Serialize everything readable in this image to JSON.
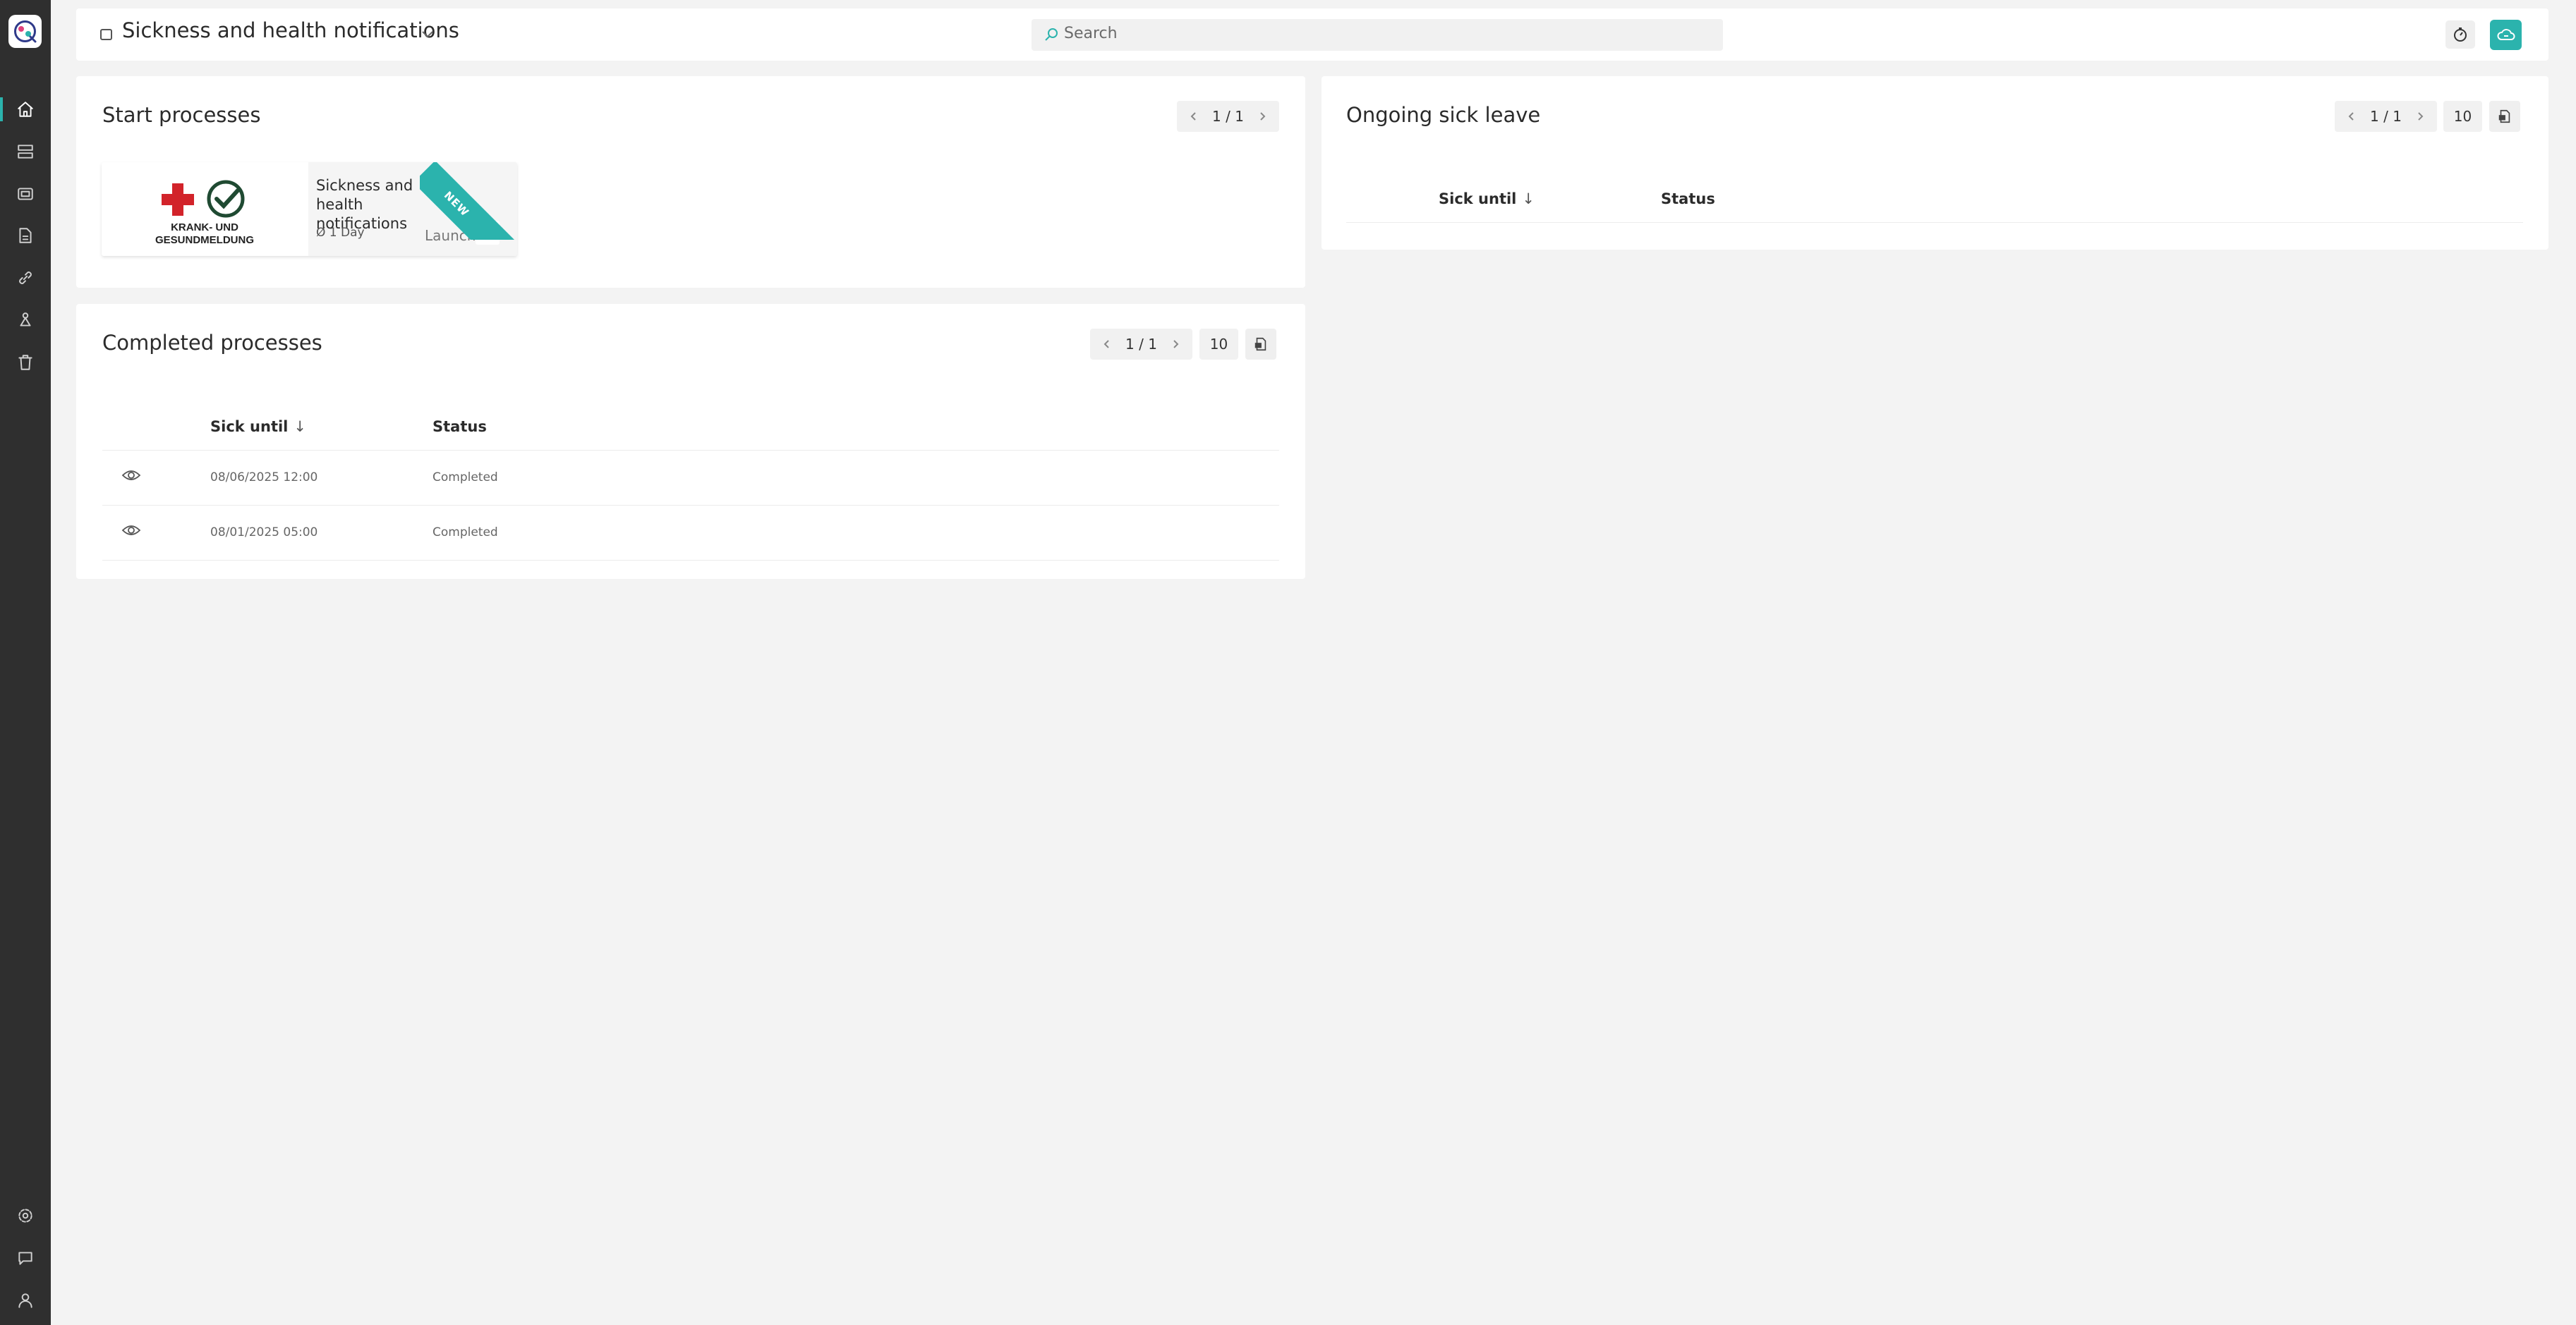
{
  "header": {
    "title": "Sickness and health notifications",
    "search_placeholder": "Search"
  },
  "start_processes": {
    "title": "Start processes",
    "pager": "1 / 1",
    "card": {
      "logo_text_line1": "KRANK- UND",
      "logo_text_line2": "GESUNDMELDUNG",
      "title": "Sickness and health notifications",
      "duration": "Ø 1 Day",
      "launch_label": "Launch",
      "ribbon": "NEW"
    }
  },
  "completed_processes": {
    "title": "Completed processes",
    "pager": "1 / 1",
    "page_size": "10",
    "columns": [
      "Sick until",
      "Status"
    ],
    "rows": [
      {
        "sick_until": "08/06/2025 12:00",
        "status": "Completed"
      },
      {
        "sick_until": "08/01/2025 05:00",
        "status": "Completed"
      }
    ]
  },
  "ongoing_sick_leave": {
    "title": "Ongoing sick leave",
    "pager": "1 / 1",
    "page_size": "10",
    "columns": [
      "Sick until",
      "Status"
    ]
  },
  "colors": {
    "accent": "#2bb3ad",
    "sidebar": "#2f2f2f",
    "background": "#f3f3f3"
  },
  "sidebar_icons": [
    "home-icon",
    "layout-icon",
    "inbox-icon",
    "report-icon",
    "link-icon",
    "network-icon",
    "trash-icon",
    "settings-icon",
    "chat-icon",
    "user-icon"
  ]
}
